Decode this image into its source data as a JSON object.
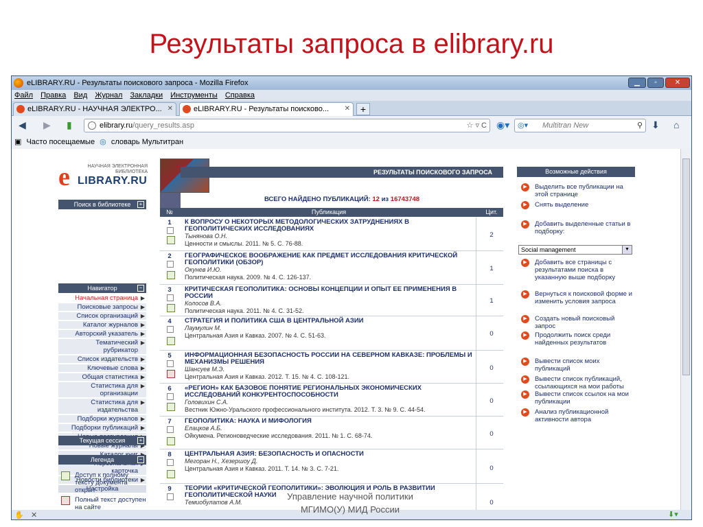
{
  "slide_title": "Результаты запроса в elibrary.ru",
  "window_title": "eLIBRARY.RU - Результаты поискового запроса - Mozilla Firefox",
  "menu": [
    "Файл",
    "Правка",
    "Вид",
    "Журнал",
    "Закладки",
    "Инструменты",
    "Справка"
  ],
  "tabs": [
    {
      "label": "eLIBRARY.RU - НАУЧНАЯ ЭЛЕКТРО..."
    },
    {
      "label": "eLIBRARY.RU - Результаты поисково..."
    }
  ],
  "url": {
    "host": "elibrary.ru",
    "path": "/query_results.asp"
  },
  "search_placeholder": "Multitran New",
  "bookmarks": [
    "Часто посещаемые",
    "словарь Мультитран"
  ],
  "logo": {
    "top": "НАУЧНАЯ ЭЛЕКТРОННАЯ БИБЛИОТЕКА",
    "brand": "LIBRARY.RU",
    "e": "e"
  },
  "sidebar": {
    "search_label": "Поиск в библиотеке",
    "navigator_label": "Навигатор",
    "items": [
      "Начальная страница",
      "Поисковые запросы",
      "Список организаций",
      "Каталог журналов",
      "Авторский указатель",
      "Тематический рубрикатор",
      "Список издательств",
      "Ключевые слова",
      "Общая статистика",
      "Статистика для организации",
      "Статистика для издательства",
      "Подборки журналов",
      "Подборки публикаций",
      "Новые поступления",
      "Новые журналы",
      "Каталог книг",
      "Персональная карточка",
      "Новости библиотеки"
    ],
    "settings_label": "Настройка",
    "session_label": "Текущая сессия",
    "legend_label": "Легенда",
    "legend_items": [
      "Доступ к полному тексту документа открыт",
      "Полный текст доступен на сайте"
    ]
  },
  "results": {
    "header": "РЕЗУЛЬТАТЫ ПОИСКОВОГО ЗАПРОСА",
    "total_prefix": "ВСЕГО НАЙДЕНО ПУБЛИКАЦИЙ:",
    "total_count": "12",
    "total_mid": "из",
    "total_all": "16743748",
    "col_num": "№",
    "col_pub": "Публикация",
    "col_cit": "Цит.",
    "rows": [
      {
        "n": "1",
        "title": "К ВОПРОСУ О НЕКОТОРЫХ МЕТОДОЛОГИЧЕСКИХ ЗАТРУДНЕНИЯХ В ГЕОПОЛИТИЧЕСКИХ ИССЛЕДОВАНИЯХ",
        "author": "Тынянова О.Н.",
        "source": "Ценности и смыслы. 2011. № 5. С. 76-88.",
        "cit": "2"
      },
      {
        "n": "2",
        "title": "ГЕОГРАФИЧЕСКОЕ ВООБРАЖЕНИЕ КАК ПРЕДМЕТ ИССЛЕДОВАНИЯ КРИТИЧЕСКОЙ ГЕОПОЛИТИКИ (ОБЗОР)",
        "author": "Окунев И.Ю.",
        "source": "Политическая наука. 2009. № 4. С. 126-137.",
        "cit": "1"
      },
      {
        "n": "3",
        "title": "КРИТИЧЕСКАЯ ГЕОПОЛИТИКА: ОСНОВЫ КОНЦЕПЦИИ И ОПЫТ ЕЕ ПРИМЕНЕНИЯ В РОССИИ",
        "author": "Колосов В.А.",
        "source": "Политическая наука. 2011. № 4. С. 31-52.",
        "cit": "1"
      },
      {
        "n": "4",
        "title": "СТРАТЕГИЯ И ПОЛИТИКА США В ЦЕНТРАЛЬНОЙ АЗИИ",
        "author": "Лаумулин М.",
        "source": "Центральная Азия и Кавказ. 2007. № 4. С. 51-63.",
        "cit": "0"
      },
      {
        "n": "5",
        "title": "ИНФОРМАЦИОННАЯ БЕЗОПАСНОСТЬ РОССИИ НА СЕВЕРНОМ КАВКАЗЕ: ПРОБЛЕМЫ И МЕХАНИЗМЫ РЕШЕНИЯ",
        "author": "Шансуев М.Э.",
        "source": "Центральная Азия и Кавказ. 2012. Т. 15. № 4. С. 108-121.",
        "cit": "0"
      },
      {
        "n": "6",
        "title": "«РЕГИОН» КАК БАЗОВОЕ ПОНЯТИЕ РЕГИОНАЛЬНЫХ ЭКОНОМИЧЕСКИХ ИССЛЕДОВАНИЙ КОНКУРЕНТОСПОСОБНОСТИ",
        "author": "Головихин С.А.",
        "source": "Вестник Южно-Уральского профессионального института. 2012. Т. 3. № 9. С. 44-54.",
        "cit": "0"
      },
      {
        "n": "7",
        "title": "ГЕОПОЛИТИКА: НАУКА И МИФОЛОГИЯ",
        "author": "Елацков А.Б.",
        "source": "Ойкумена. Регионоведческие исследования. 2011. № 1. С. 68-74.",
        "cit": "0"
      },
      {
        "n": "8",
        "title": "ЦЕНТРАЛЬНАЯ АЗИЯ: БЕЗОПАСНОСТЬ И ОПАСНОСТИ",
        "author": "Мегоран Н., Хезершоу Д.",
        "source": "Центральная Азия и Кавказ. 2011. Т. 14. № 3. С. 7-21.",
        "cit": "0"
      },
      {
        "n": "9",
        "title": "ТЕОРИИ «КРИТИЧЕСКОЙ ГЕОПОЛИТИКИ»: ЭВОЛЮЦИЯ И РОЛЬ В РАЗВИТИИ ГЕОПОЛИТИЧЕСКОЙ НАУКИ",
        "author": "Темиобулатов А.М.",
        "source": "",
        "cit": "0"
      }
    ]
  },
  "actions": {
    "header": "Возможные действия",
    "items": [
      "Выделить все публикации на этой странице",
      "Снять выделение",
      "Добавить выделенные статьи в подборку:",
      "Добавить все страницы с результатами поиска в указанную выше подборку",
      "Вернуться к поисковой форме и изменить условия запроса",
      "Создать новый поисковый запрос",
      "Продолжить поиск среди найденных результатов",
      "Вывести список моих публикаций",
      "Вывести список публикаций, ссылающихся на мои работы",
      "Вывести список ссылок на мои публикации",
      "Анализ публикационной активности автора"
    ],
    "select_value": "Social management"
  },
  "footer": {
    "line1": "Управление научной политики",
    "line2": "МГИМО(У) МИД России"
  }
}
